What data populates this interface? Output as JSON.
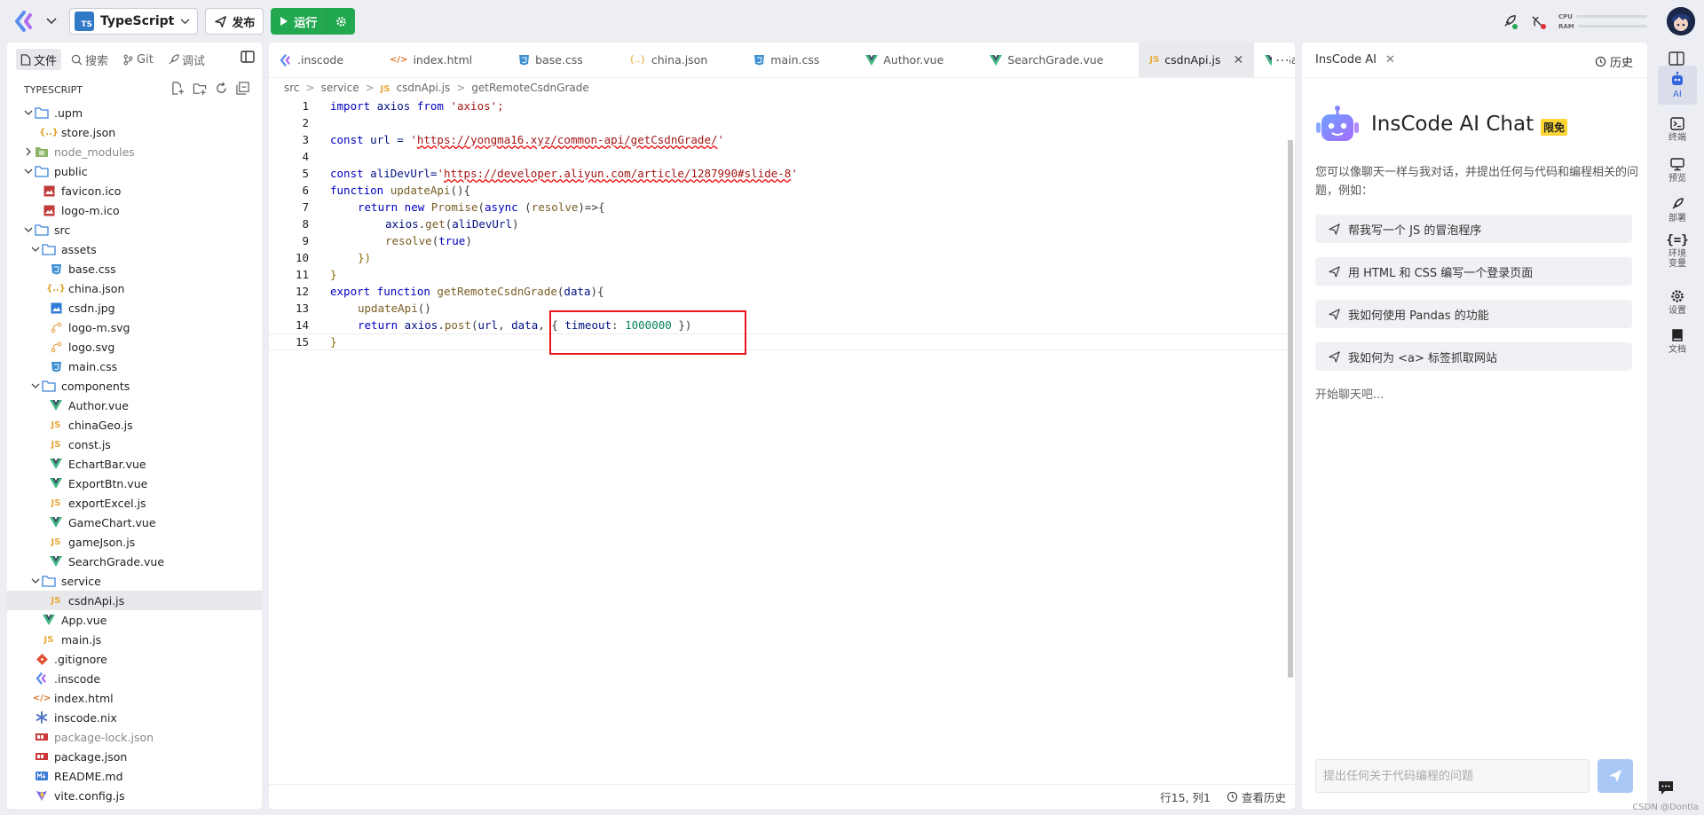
{
  "topbar": {
    "language_label": "TypeScript",
    "language_badge": "TS",
    "publish_label": "发布",
    "run_label": "运行",
    "cpu_label": "CPU",
    "ram_label": "RAM"
  },
  "sidebar": {
    "tabs": [
      {
        "label": "文件",
        "icon": "file-icon"
      },
      {
        "label": "搜索",
        "icon": "search-icon"
      },
      {
        "label": "Git",
        "icon": "git-icon"
      },
      {
        "label": "调试",
        "icon": "debug-icon"
      }
    ],
    "section_title": "TYPESCRIPT",
    "tree": [
      {
        "label": ".upm",
        "type": "folder",
        "depth": 0,
        "open": true
      },
      {
        "label": "store.json",
        "type": "json",
        "depth": 1
      },
      {
        "label": "node_modules",
        "type": "folder-dim",
        "depth": 0,
        "open": false,
        "dim": true
      },
      {
        "label": "public",
        "type": "folder",
        "depth": 0,
        "open": true
      },
      {
        "label": "favicon.ico",
        "type": "image",
        "depth": 1
      },
      {
        "label": "logo-m.ico",
        "type": "image",
        "depth": 1
      },
      {
        "label": "src",
        "type": "folder",
        "depth": 0,
        "open": true
      },
      {
        "label": "assets",
        "type": "folder",
        "depth": 1,
        "open": true
      },
      {
        "label": "base.css",
        "type": "css",
        "depth": 2
      },
      {
        "label": "china.json",
        "type": "json",
        "depth": 2
      },
      {
        "label": "csdn.jpg",
        "type": "jpg",
        "depth": 2
      },
      {
        "label": "logo-m.svg",
        "type": "svg",
        "depth": 2
      },
      {
        "label": "logo.svg",
        "type": "svg",
        "depth": 2
      },
      {
        "label": "main.css",
        "type": "css",
        "depth": 2
      },
      {
        "label": "components",
        "type": "folder",
        "depth": 1,
        "open": true
      },
      {
        "label": "Author.vue",
        "type": "vue",
        "depth": 2
      },
      {
        "label": "chinaGeo.js",
        "type": "js",
        "depth": 2
      },
      {
        "label": "const.js",
        "type": "js",
        "depth": 2
      },
      {
        "label": "EchartBar.vue",
        "type": "vue",
        "depth": 2
      },
      {
        "label": "ExportBtn.vue",
        "type": "vue",
        "depth": 2
      },
      {
        "label": "exportExcel.js",
        "type": "js",
        "depth": 2
      },
      {
        "label": "GameChart.vue",
        "type": "vue",
        "depth": 2
      },
      {
        "label": "gameJson.js",
        "type": "js",
        "depth": 2
      },
      {
        "label": "SearchGrade.vue",
        "type": "vue",
        "depth": 2
      },
      {
        "label": "service",
        "type": "folder",
        "depth": 1,
        "open": true
      },
      {
        "label": "csdnApi.js",
        "type": "js",
        "depth": 2,
        "selected": true
      },
      {
        "label": "App.vue",
        "type": "vue",
        "depth": 1
      },
      {
        "label": "main.js",
        "type": "js",
        "depth": 1
      },
      {
        "label": ".gitignore",
        "type": "git",
        "depth": 0
      },
      {
        "label": ".inscode",
        "type": "inscode",
        "depth": 0
      },
      {
        "label": "index.html",
        "type": "html",
        "depth": 0
      },
      {
        "label": "inscode.nix",
        "type": "nix",
        "depth": 0
      },
      {
        "label": "package-lock.json",
        "type": "npm",
        "depth": 0,
        "dim": true
      },
      {
        "label": "package.json",
        "type": "npm",
        "depth": 0
      },
      {
        "label": "README.md",
        "type": "md",
        "depth": 0
      },
      {
        "label": "vite.config.js",
        "type": "vite",
        "depth": 0
      }
    ]
  },
  "editor": {
    "tabs": [
      {
        "label": ".inscode",
        "type": "inscode"
      },
      {
        "label": "index.html",
        "type": "html"
      },
      {
        "label": "base.css",
        "type": "css"
      },
      {
        "label": "china.json",
        "type": "json"
      },
      {
        "label": "main.css",
        "type": "css"
      },
      {
        "label": "Author.vue",
        "type": "vue"
      },
      {
        "label": "SearchGrade.vue",
        "type": "vue"
      },
      {
        "label": "csdnApi.js",
        "type": "js",
        "active": true
      },
      {
        "label": "GameC",
        "type": "vue"
      }
    ],
    "breadcrumb": [
      "src",
      "service",
      "csdnApi.js",
      "getRemoteCsdnGrade"
    ],
    "line_numbers": [
      "1",
      "2",
      "3",
      "4",
      "5",
      "6",
      "7",
      "8",
      "9",
      "10",
      "11",
      "12",
      "13",
      "14",
      "15"
    ],
    "code": {
      "l1": {
        "kw": "import",
        "id": " axios ",
        "kw2": "from",
        "str": " 'axios';"
      },
      "l3": {
        "kw": "const",
        "id": " url = ",
        "q1": "'",
        "url": "https://yongma16.xyz/common-api/getCsdnGrade/",
        "q2": "'"
      },
      "l5": {
        "kw": "const",
        "id": " aliDevUrl=",
        "q1": "'",
        "url": "https://developer.aliyun.com/article/1287990#slide-8",
        "q2": "'"
      },
      "l6": {
        "kw": "function",
        "fn": " updateApi",
        "rest": "(){"
      },
      "l7": {
        "kw": "return",
        "kw2": " new",
        "fn": " Promise",
        "p1": "(",
        "kw3": "async",
        "p2": " (",
        "v": "resolve",
        "p3": ")=>{"
      },
      "l8": {
        "v": "axios",
        "p": ".",
        "fn": "get",
        "p2": "(",
        "v2": "aliDevUrl",
        "p3": ")"
      },
      "l9": {
        "fn": "resolve",
        "p": "(",
        "kw": "true",
        "p2": ")"
      },
      "l10": "})",
      "l11": "}",
      "l12": {
        "kw": "export",
        "kw2": " function",
        "fn": " getRemoteCsdnGrade",
        "p": "(",
        "v": "data",
        "p2": "){"
      },
      "l13": {
        "fn": "updateApi",
        "p": "()"
      },
      "l14": {
        "kw": "return",
        "v": " axios",
        "p": ".",
        "fn": "post",
        "p2": "(",
        "v2": "url",
        "p3": ", ",
        "v3": "data",
        "p4": ", ",
        "obj1": "{ ",
        "v4": "timeout",
        "p5": ": ",
        "n": "1000000",
        "obj2": " })"
      },
      "l15": "}"
    },
    "status": {
      "position": "行15, 列1",
      "history": "查看历史"
    }
  },
  "ai": {
    "tab_label": "InsCode AI",
    "history_label": "历史",
    "title": "InsCode AI Chat",
    "badge": "限免",
    "description": "您可以像聊天一样与我对话，并提出任何与代码和编程相关的问题，例如：",
    "suggestions": [
      "帮我写一个 JS 的冒泡程序",
      "用 HTML 和 CSS 编写一个登录页面",
      "我如何使用 Pandas 的功能",
      "我如何为 <a> 标签抓取网站"
    ],
    "start_text": "开始聊天吧...",
    "input_placeholder": "提出任何关于代码编程的问题"
  },
  "rail": {
    "items": [
      {
        "label": "AI",
        "icon": "robot-icon",
        "active": true
      },
      {
        "label": "终端",
        "icon": "terminal-icon"
      },
      {
        "label": "预览",
        "icon": "monitor-icon"
      },
      {
        "label": "部署",
        "icon": "rocket-icon"
      },
      {
        "label": "环境\n变量",
        "icon": "braces-icon"
      },
      {
        "label": "设置",
        "icon": "settings-icon"
      },
      {
        "label": "文档",
        "icon": "book-icon"
      }
    ]
  },
  "watermark": "CSDN @Dontla",
  "colors": {
    "run_green": "#22a94f",
    "highlight_red": "#e8151b",
    "keyword": "#0000c0",
    "string": "#a31515",
    "number": "#098658",
    "active_rail": "#3366dd",
    "ai_badge": "#fcd535"
  }
}
